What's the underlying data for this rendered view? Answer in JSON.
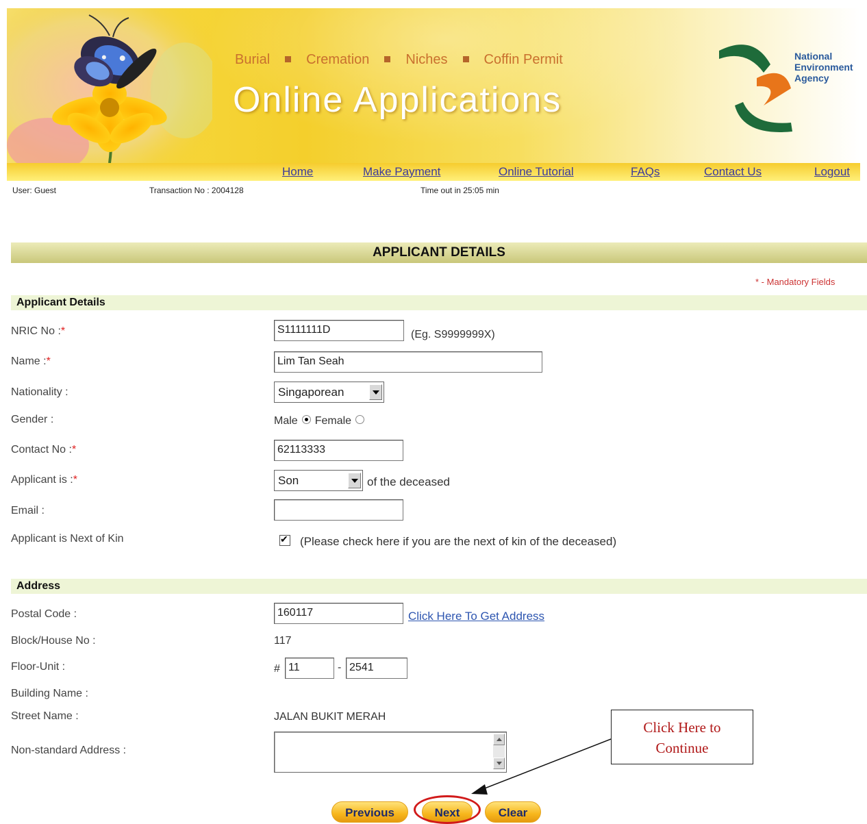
{
  "banner": {
    "services": [
      "Burial",
      "Cremation",
      "Niches",
      "Coffin Permit"
    ],
    "title": "Online Applications",
    "agency": [
      "National",
      "Environment",
      "Agency"
    ]
  },
  "menu": {
    "home": "Home",
    "make_payment": "Make Payment",
    "online_tutorial": "Online Tutorial",
    "faqs": "FAQs",
    "contact_us": "Contact Us",
    "logout": "Logout"
  },
  "status": {
    "user": "User: Guest",
    "transaction": "Transaction No : 2004128",
    "timeout": "Time out in 25:05 min"
  },
  "section_title": "APPLICANT DETAILS",
  "mandatory_note": "* - Mandatory Fields",
  "applicant": {
    "header": "Applicant Details",
    "nric_label": "NRIC No :",
    "nric_value": "S1111111D",
    "nric_hint": "(Eg. S9999999X)",
    "name_label": "Name :",
    "name_value": "Lim Tan Seah",
    "nationality_label": "Nationality :",
    "nationality_value": "Singaporean",
    "gender_label": "Gender :",
    "gender_male": "Male",
    "gender_female": "Female",
    "contact_label": "Contact No :",
    "contact_value": "62113333",
    "relation_label": "Applicant is :",
    "relation_value": "Son",
    "relation_suffix": "of the deceased",
    "email_label": "Email :",
    "email_value": "",
    "nok_label": "Applicant is Next of Kin",
    "nok_text": "(Please check here if you are the next of kin of the deceased)"
  },
  "address": {
    "header": "Address",
    "postal_label": "Postal Code :",
    "postal_value": "160117",
    "get_address_link": "Click Here To Get Address",
    "block_label": "Block/House No :",
    "block_value": "117",
    "floor_label": "Floor-Unit :",
    "floor_hash": "#",
    "floor_value": "11",
    "floor_dash": "-",
    "unit_value": "2541",
    "building_label": "Building Name :",
    "street_label": "Street Name :",
    "street_value": "JALAN BUKIT MERAH",
    "nonstandard_label": "Non-standard Address :"
  },
  "callout": {
    "line1": "Click Here to",
    "line2": "Continue"
  },
  "buttons": {
    "previous": "Previous",
    "next": "Next",
    "clear": "Clear"
  },
  "colors": {
    "banner_gold": "#f4cf2c",
    "link_blue": "#2d55b0",
    "required_red": "#e02020",
    "callout_red": "#b01818"
  }
}
